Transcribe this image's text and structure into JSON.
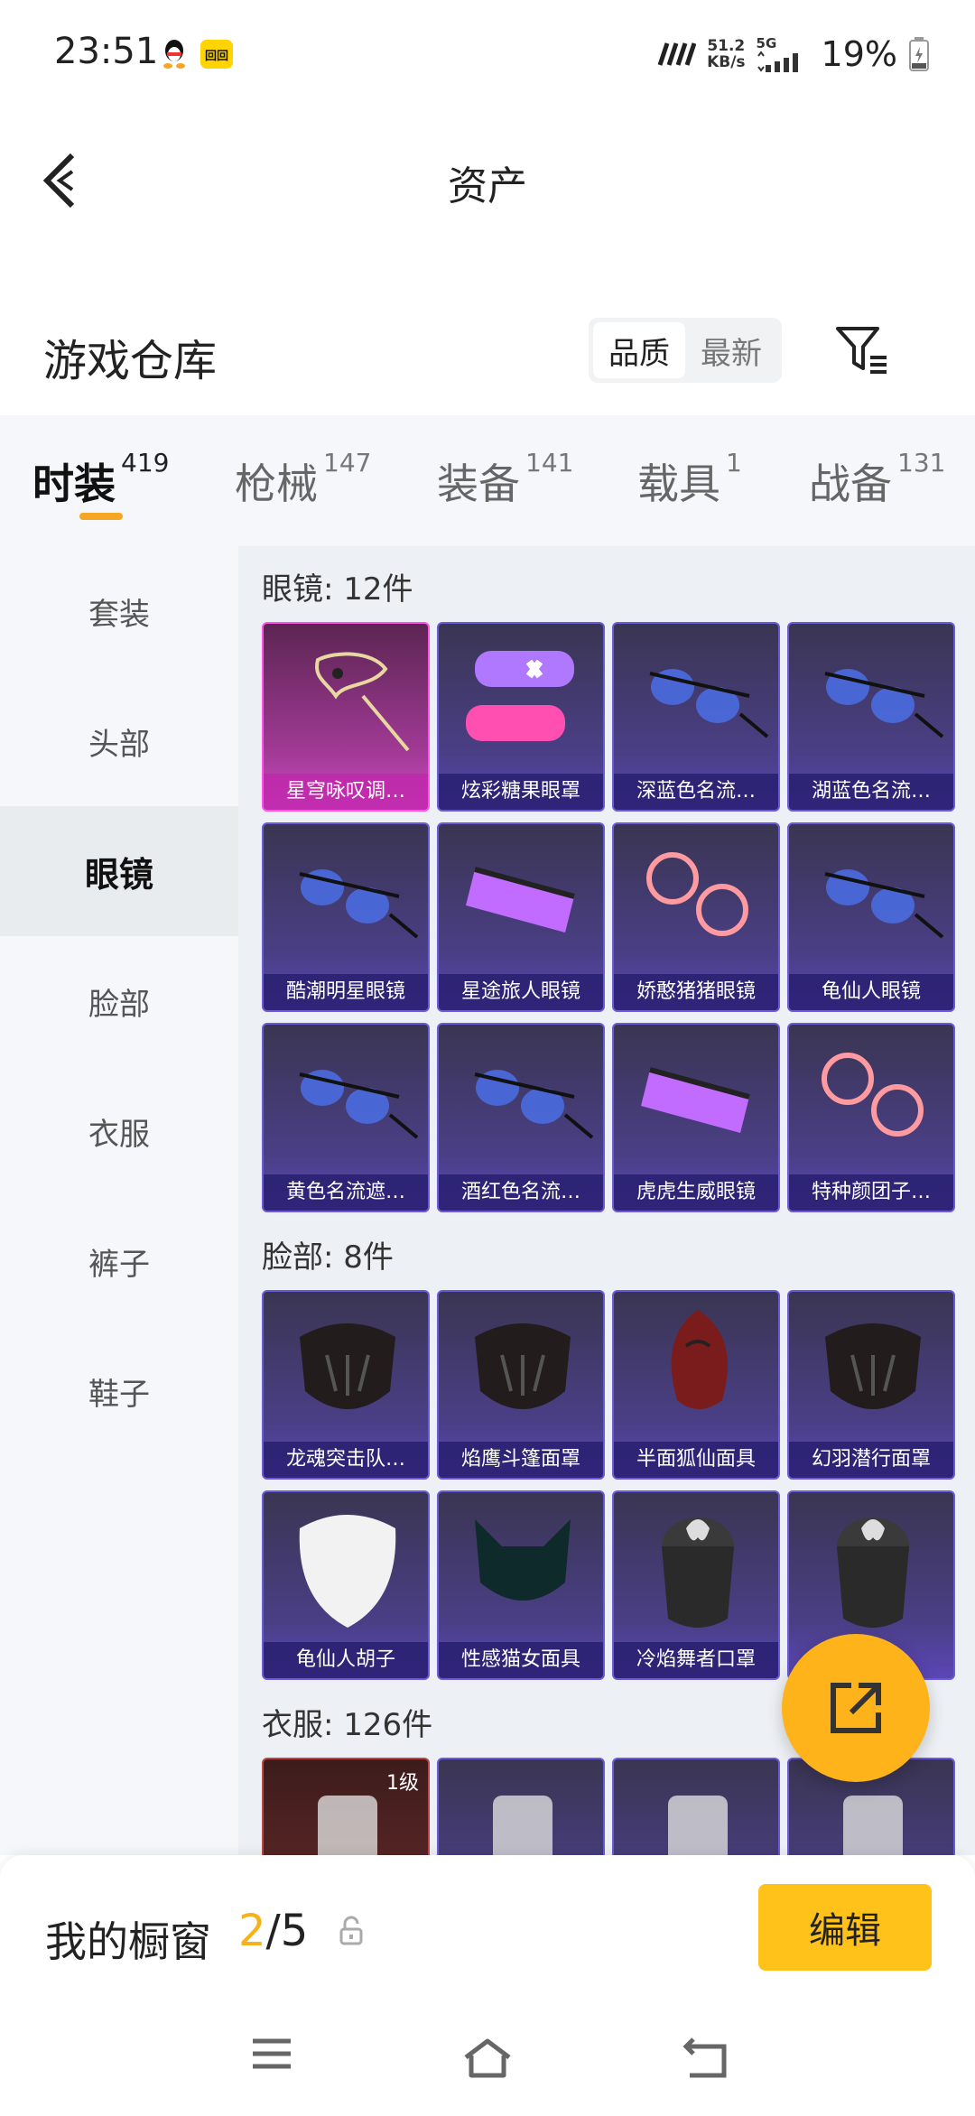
{
  "status": {
    "time": "23:51",
    "app_badge": "回回",
    "net_speed_value": "51.2",
    "net_speed_unit": "KB/s",
    "network": "5G",
    "battery": "19%"
  },
  "header": {
    "title": "资产"
  },
  "warehouse": {
    "title": "游戏仓库",
    "sort_options": [
      "品质",
      "最新"
    ],
    "active_sort": "品质"
  },
  "tabs": [
    {
      "label": "时装",
      "count": "419",
      "active": true
    },
    {
      "label": "枪械",
      "count": "147"
    },
    {
      "label": "装备",
      "count": "141"
    },
    {
      "label": "载具",
      "count": "1"
    },
    {
      "label": "战备",
      "count": "131"
    }
  ],
  "sidenav": [
    {
      "label": "套装"
    },
    {
      "label": "头部"
    },
    {
      "label": "眼镜",
      "active": true
    },
    {
      "label": "脸部"
    },
    {
      "label": "衣服"
    },
    {
      "label": "裤子"
    },
    {
      "label": "鞋子"
    }
  ],
  "sections": [
    {
      "title": "眼镜: 12件",
      "items": [
        {
          "name": "星穹咏叹调…",
          "rarity": "pink",
          "icon": "mask-icon"
        },
        {
          "name": "炫彩糖果眼罩",
          "icon": "eye-patch-icon"
        },
        {
          "name": "深蓝色名流…",
          "icon": "sunglasses-icon"
        },
        {
          "name": "湖蓝色名流…",
          "icon": "sunglasses-icon"
        },
        {
          "name": "酷潮明星眼镜",
          "icon": "sunglasses-icon"
        },
        {
          "name": "星途旅人眼镜",
          "icon": "goggles-icon"
        },
        {
          "name": "娇憨猪猪眼镜",
          "icon": "glasses-icon"
        },
        {
          "name": "龟仙人眼镜",
          "icon": "sunglasses-icon"
        },
        {
          "name": "黄色名流遮…",
          "icon": "sunglasses-icon"
        },
        {
          "name": "酒红色名流…",
          "icon": "sunglasses-icon"
        },
        {
          "name": "虎虎生威眼镜",
          "icon": "goggles-icon"
        },
        {
          "name": "特种颜团子…",
          "icon": "glasses-icon"
        }
      ]
    },
    {
      "title": "脸部: 8件",
      "items": [
        {
          "name": "龙魂突击队…",
          "icon": "face-mask-icon"
        },
        {
          "name": "焰鹰斗篷面罩",
          "icon": "face-mask-icon"
        },
        {
          "name": "半面狐仙面具",
          "icon": "fox-mask-icon"
        },
        {
          "name": "幻羽潜行面罩",
          "icon": "face-mask-icon"
        },
        {
          "name": "龟仙人胡子",
          "icon": "beard-icon"
        },
        {
          "name": "性感猫女面具",
          "icon": "cat-mask-icon"
        },
        {
          "name": "冷焰舞者口罩",
          "icon": "neck-gaiter-icon"
        },
        {
          "name": "",
          "icon": "neck-gaiter-icon"
        }
      ]
    },
    {
      "title": "衣服: 126件",
      "items": [
        {
          "name": "",
          "rarity": "red",
          "level": "1级",
          "icon": "outfit-icon"
        },
        {
          "name": "",
          "icon": "outfit-icon"
        },
        {
          "name": "",
          "icon": "outfit-icon"
        },
        {
          "name": "",
          "icon": "outfit-icon"
        }
      ]
    }
  ],
  "bottom": {
    "label": "我的橱窗",
    "current": "2",
    "total": "/5",
    "edit_label": "编辑"
  }
}
